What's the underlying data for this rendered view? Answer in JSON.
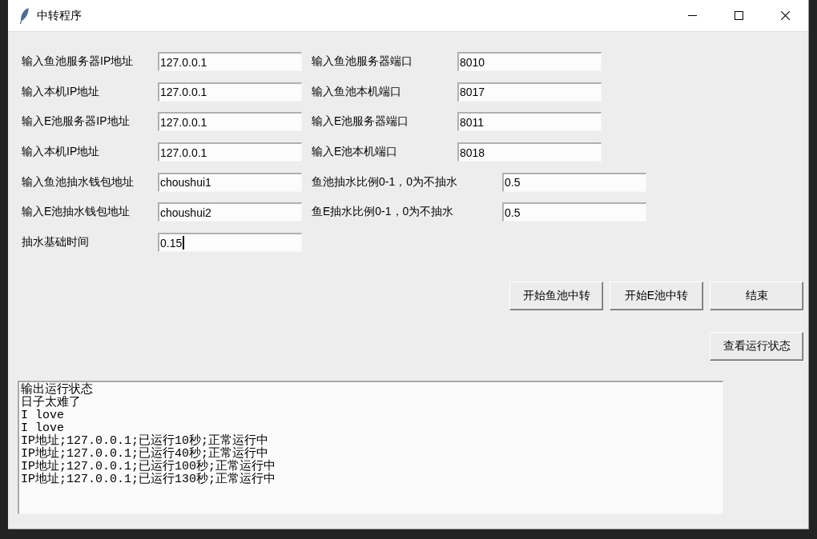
{
  "window": {
    "title": "中转程序"
  },
  "form_blocks": [
    {
      "rows": [
        [
          {
            "label": "输入鱼池服务器IP地址",
            "value": "127.0.0.1",
            "focused": false
          },
          {
            "label": "输入鱼池服务器端口",
            "value": "8010",
            "focused": false
          }
        ],
        [
          {
            "label": "输入本机IP地址",
            "value": "127.0.0.1",
            "focused": false
          },
          {
            "label": "输入鱼池本机端口",
            "value": "8017",
            "focused": false
          }
        ],
        [
          {
            "label": "输入E池服务器IP地址",
            "value": "127.0.0.1",
            "focused": false
          },
          {
            "label": "输入E池服务器端口",
            "value": "8011",
            "focused": false
          }
        ],
        [
          {
            "label": "输入本机IP地址",
            "value": "127.0.0.1",
            "focused": false
          },
          {
            "label": "输入E池本机端口",
            "value": "8018",
            "focused": false
          }
        ]
      ]
    },
    {
      "rows": [
        [
          {
            "label": "输入鱼池抽水钱包地址",
            "value": "choushui1",
            "focused": false
          },
          {
            "label": "鱼池抽水比例0-1，0为不抽水",
            "value": "0.5",
            "focused": false
          }
        ],
        [
          {
            "label": "输入E池抽水钱包地址",
            "value": "choushui2",
            "focused": false
          },
          {
            "label": "鱼E抽水比例0-1，0为不抽水",
            "value": "0.5",
            "focused": false
          }
        ],
        [
          {
            "label": "抽水基础时间",
            "value": "0.15",
            "focused": true
          }
        ]
      ]
    }
  ],
  "button_rows": [
    [
      "开始鱼池中转",
      "开始E池中转",
      "结束"
    ],
    [
      "查看运行状态"
    ]
  ],
  "output": {
    "lines": [
      "输出运行状态",
      "日子太难了",
      "I love",
      "I love",
      "IP地址;127.0.0.1;已运行10秒;正常运行中",
      "IP地址;127.0.0.1;已运行40秒;正常运行中",
      "IP地址;127.0.0.1;已运行100秒;正常运行中",
      "IP地址;127.0.0.1;已运行130秒;正常运行中"
    ]
  }
}
